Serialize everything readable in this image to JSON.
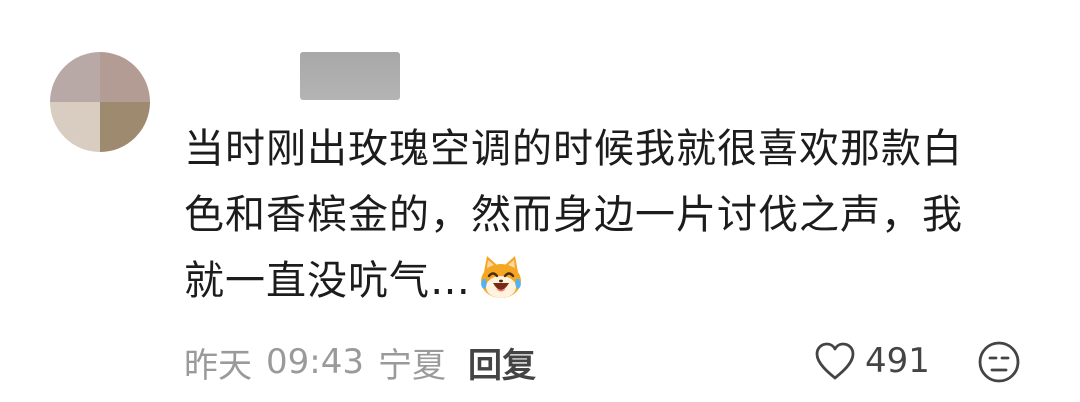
{
  "comment": {
    "avatar_icon": "blurred-avatar",
    "username_state": "blurred",
    "text_lines": [
      "当时刚出玫瑰空调的时候我就很喜欢那款白",
      "色和香槟金的，然而身边一片讨伐之声，我",
      "就一直没吭气…"
    ],
    "trailing_emoji": "laughing-crying-cat-emoji",
    "date": "昨天",
    "time": "09:43",
    "location": "宁夏",
    "reply_label": "回复",
    "like_icon": "heart-outline-icon",
    "like_count": "491",
    "dislike_icon": "frown-face-icon"
  },
  "colors": {
    "text": "#1c1c1c",
    "meta_text": "#9a9a9a",
    "reply_text": "#444444"
  }
}
